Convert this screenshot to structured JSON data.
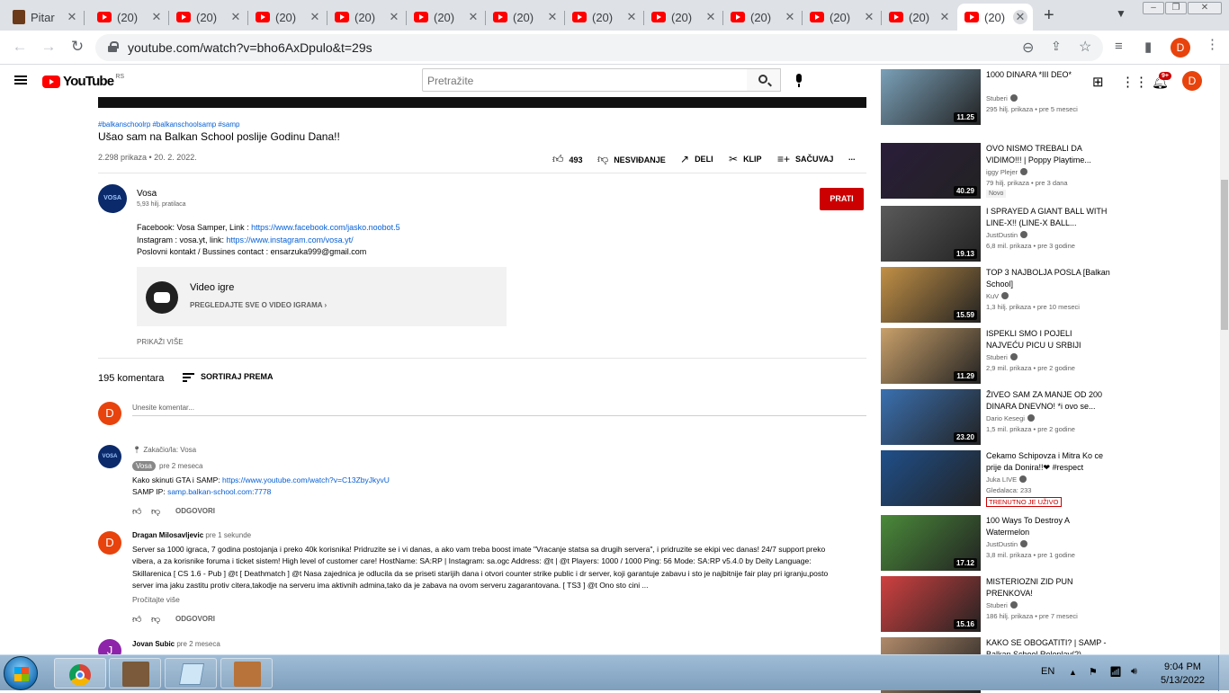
{
  "browser": {
    "tabs": [
      {
        "title": "Pitar",
        "icon": "app-icon"
      },
      {
        "title": "(20)",
        "icon": "youtube-icon"
      },
      {
        "title": "(20)",
        "icon": "youtube-icon"
      },
      {
        "title": "(20)",
        "icon": "youtube-icon"
      },
      {
        "title": "(20)",
        "icon": "youtube-icon"
      },
      {
        "title": "(20)",
        "icon": "youtube-icon"
      },
      {
        "title": "(20)",
        "icon": "youtube-icon"
      },
      {
        "title": "(20)",
        "icon": "youtube-icon"
      },
      {
        "title": "(20)",
        "icon": "youtube-icon"
      },
      {
        "title": "(20)",
        "icon": "youtube-icon"
      },
      {
        "title": "(20)",
        "icon": "youtube-icon"
      },
      {
        "title": "(20)",
        "icon": "youtube-icon"
      },
      {
        "title": "(20)",
        "icon": "youtube-icon",
        "active": true
      }
    ],
    "url": "youtube.com/watch?v=bho6AxDpulo&t=29s",
    "profile_initial": "D"
  },
  "youtube": {
    "logo_text": "YouTube",
    "country": "RS",
    "search_placeholder": "Pretražite",
    "notifications": "9+",
    "avatar_initial": "D"
  },
  "video": {
    "tags": "#balkanschoolrp #balkanschoolsamp #samp",
    "title": "Ušao sam na Balkan School poslije Godinu Dana!!",
    "meta": "2.298 prikaza • 20. 2. 2022.",
    "actions": {
      "likes": "493",
      "dislike": "NESVIĐANJE",
      "share": "DELI",
      "clip": "KLIP",
      "save": "SAČUVAJ",
      "more": "..."
    },
    "channel": {
      "name": "Vosa",
      "subscribers": "5,93 hilj. pratilaca",
      "avatar_text": "VOSA",
      "subscribe_label": "PRATI"
    },
    "description": {
      "line1_prefix": "Facebook: Vosa Samper, Link : ",
      "line1_link": "https://www.facebook.com/jasko.noobot.5",
      "line2_prefix": "Instagram : vosa.yt, link: ",
      "line2_link": "https://www.instagram.com/vosa.yt/",
      "line3": "Poslovni kontakt / Bussines contact : ensarzuka999@gmail.com"
    },
    "game": {
      "title": "Video igre",
      "link": "PREGLEDAJTE SVE O VIDEO IGRAMA"
    },
    "show_more": "PRIKAŽI VIŠE"
  },
  "comments": {
    "count": "195 komentara",
    "sort_label": "SORTIRAJ PREMA",
    "input_placeholder": "Unesite komentar...",
    "user_initial": "D",
    "pinned": {
      "pinned_by": "Zakačio/la: Vosa",
      "author": "Vosa",
      "time": "pre 2 meseca",
      "line1_prefix": "Kako skinuti GTA i SAMP: ",
      "line1_link": "https://www.youtube.com/watch?v=C13ZbyJkyvU",
      "line2_prefix": "SAMP IP: ",
      "line2_link": "samp.balkan-school.com:7778",
      "reply": "ODGOVORI"
    },
    "second": {
      "author": "Dragan Milosavljevic",
      "time": "pre 1 sekunde",
      "initial": "D",
      "text": "Server sa 1000 igraca, 7 godina postojanja i preko 40k korisnika! Pridruzite se i vi danas, a ako vam treba boost imate \"Vracanje statsa sa drugih servera\", i pridruzite se ekipi vec danas! 24/7 support preko vibera, a za korisnike foruma i ticket sistem! High level of customer care! HostName: SA:RP | Instagram: sa.ogc Address: @t | @t Players: 1000 / 1000 Ping: 56 Mode: SA:RP v5.4.0 by Deity Language: Skillarenica [ CS 1.6 - Pub ] @t [ Deathmatch ] @t Nasa zajednica je odlucila da se priseti starijih dana i otvori counter strike public i dr server, koji garantuje zabavu i sto je najbitnije fair play pri igranju,posto server ima jaku zastitu protiv citera,takodje na serveru ima aktivnih admina,tako da je zabava na ovom serveru zagarantovana. [ TS3 ] @t Ono sto cini ...",
      "read_more": "Pročitajte više",
      "reply": "ODGOVORI"
    },
    "third": {
      "author": "Jovan Subic",
      "time": "pre 2 meseca",
      "initial": "J"
    }
  },
  "sidebar": [
    {
      "title": "1000 DINARA *III DEO*",
      "channel": "Stuberi",
      "meta": "295 hilj. prikaza • pre 5 meseci",
      "duration": "11.25",
      "color": "#7aa0b8"
    },
    {
      "title": "OVO NISMO TREBALI DA VIDIMO!!! | Poppy Playtime...",
      "channel": "iggy Plejer",
      "meta": "79 hilj. prikaza • pre 3 dana",
      "badge": "Novo",
      "duration": "40.29",
      "color": "#2a1d3a"
    },
    {
      "title": "I SPRAYED A GIANT BALL WITH LINE-X!! (LINE-X BALL...",
      "channel": "JustDustin",
      "meta": "6,8 mil. prikaza • pre 3 godine",
      "duration": "19.13",
      "color": "#5a5a5a"
    },
    {
      "title": "TOP 3 NAJBOLJA POSLA [Balkan School]",
      "channel": "KuV",
      "meta": "1,3 hilj. prikaza • pre 10 meseci",
      "duration": "15.59",
      "color": "#c29046"
    },
    {
      "title": "ISPEKLI SMO I POJELI NAJVEĆU PICU U SRBIJI",
      "channel": "Stuberi",
      "meta": "2,9 mil. prikaza • pre 2 godine",
      "duration": "11.29",
      "color": "#c9a06a"
    },
    {
      "title": "ŽIVEO SAM ZA MANJE OD 200 DINARA DNEVNO! *i ovo se...",
      "channel": "Dario Kesegi",
      "meta": "1,5 mil. prikaza • pre 2 godine",
      "duration": "23.20",
      "color": "#3a70b0"
    },
    {
      "title": "Cekamo Schipovza i Mitra Ko ce prije da Donira!!❤ #respect",
      "channel": "Juka LIVE",
      "meta": "Gledalaca: 233",
      "live": "TRENUTNO JE UŽIVO",
      "color": "#1f4f8a"
    },
    {
      "title": "100 Ways To Destroy A Watermelon",
      "channel": "JustDustin",
      "meta": "3,8 mil. prikaza • pre 1 godine",
      "duration": "17.12",
      "color": "#4a8a3a"
    },
    {
      "title": "MISTERIOZNI ZID PUN PRENKOVA!",
      "channel": "Stuberi",
      "meta": "186 hilj. prikaza • pre 7 meseci",
      "duration": "15.16",
      "color": "#d04040"
    },
    {
      "title": "KAKO SE OBOGATITI? | SAMP - Balkan School Roleplay(?)",
      "channel": "",
      "meta": "",
      "color": "#b08a6a"
    }
  ],
  "taskbar": {
    "lang": "EN",
    "time": "9:04 PM",
    "date": "5/13/2022"
  }
}
